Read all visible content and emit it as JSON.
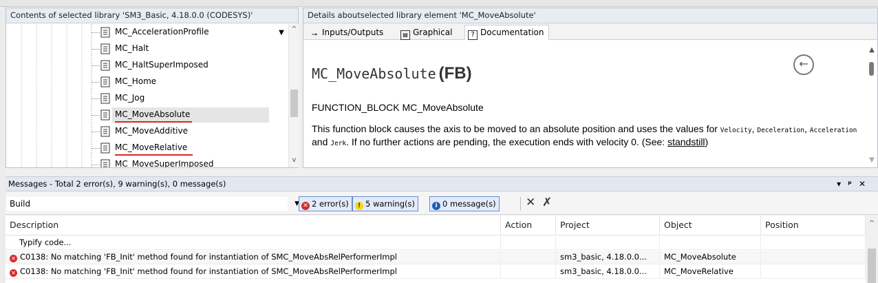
{
  "library_panel": {
    "title": "Contents of selected library 'SM3_Basic, 4.18.0.0 (CODESYS)'",
    "items": [
      {
        "label": "MC_AccelerationProfile"
      },
      {
        "label": "MC_Halt"
      },
      {
        "label": "MC_HaltSuperImposed"
      },
      {
        "label": "MC_Home"
      },
      {
        "label": "MC_Jog"
      },
      {
        "label": "MC_MoveAbsolute",
        "selected": true,
        "underlined": true
      },
      {
        "label": "MC_MoveAdditive"
      },
      {
        "label": "MC_MoveRelative",
        "underlined": true
      },
      {
        "label": "MC_MoveSuperImposed"
      }
    ]
  },
  "details_panel": {
    "title": "Details aboutselected library element 'MC_MoveAbsolute'",
    "tabs": [
      {
        "label": "Inputs/Outputs",
        "icon": "io-icon"
      },
      {
        "label": "Graphical",
        "icon": "graphical-icon"
      },
      {
        "label": "Documentation",
        "icon": "help-icon",
        "active": true
      }
    ],
    "doc": {
      "name": "MC_MoveAbsolute",
      "kind": "(FB)",
      "signature": "FUNCTION_BLOCK MC_MoveAbsolute",
      "desc_part1": "This function block causes the axis to be moved to an absolute position and uses the values for ",
      "code1": "Velocity",
      "sep1": ", ",
      "code2": "Deceleration",
      "sep2": ", ",
      "code3": "Acceleration",
      "and_text": " and ",
      "code4": "Jerk",
      "desc_part2": ". If no further actions are pending, the execution ends with velocity 0. (See: ",
      "link": "standstill",
      "desc_end": ")"
    }
  },
  "messages_panel": {
    "title": "Messages - Total 2 error(s), 9 warning(s), 0 message(s)",
    "source": "Build",
    "filters": {
      "errors": "2 error(s)",
      "warnings": "5 warning(s)",
      "messages": "0 message(s)"
    },
    "columns": [
      "Description",
      "Action",
      "Project",
      "Object",
      "Position"
    ],
    "rows": [
      {
        "description": "Typify code...",
        "action": "",
        "project": "",
        "object": "",
        "position": "",
        "error": false
      },
      {
        "description": "C0138: No matching 'FB_Init' method found for instantiation of SMC_MoveAbsRelPerformerImpl",
        "action": "",
        "project": "sm3_basic, 4.18.0.0...",
        "object": "MC_MoveAbsolute",
        "position": "",
        "error": true
      },
      {
        "description": "C0138: No matching 'FB_Init' method found for instantiation of SMC_MoveAbsRelPerformerImpl",
        "action": "",
        "project": "sm3_basic, 4.18.0.0...",
        "object": "MC_MoveRelative",
        "position": "",
        "error": true
      }
    ]
  },
  "colors": {
    "error": "#d52c2c",
    "warning": "#f2d81a",
    "info": "#1c5fb8",
    "underline": "#e0261d"
  }
}
